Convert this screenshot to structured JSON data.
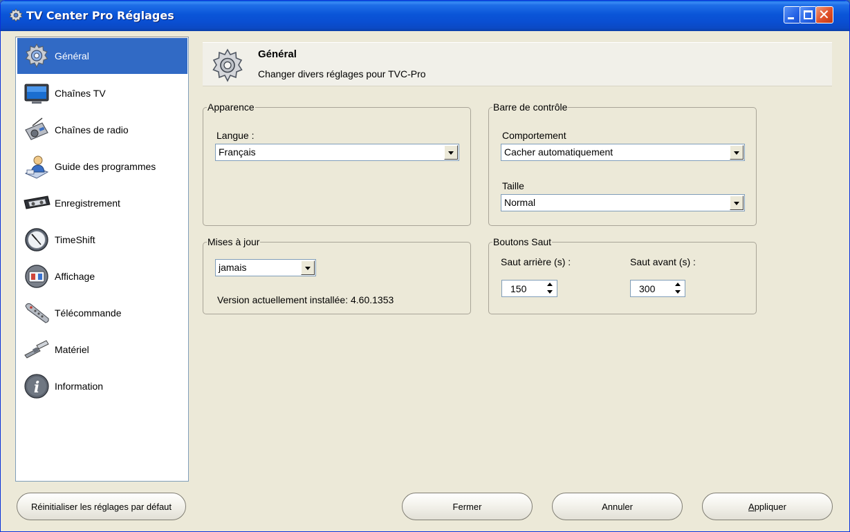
{
  "window": {
    "title": "TV Center Pro Réglages"
  },
  "sidebar": {
    "items": [
      {
        "label": "Général",
        "icon": "gear-icon",
        "active": true
      },
      {
        "label": "Chaînes TV",
        "icon": "tv-icon"
      },
      {
        "label": "Chaînes de radio",
        "icon": "radio-icon"
      },
      {
        "label": "Guide des programmes",
        "icon": "program-guide-icon"
      },
      {
        "label": "Enregistrement",
        "icon": "cassette-icon"
      },
      {
        "label": "TimeShift",
        "icon": "clock-icon"
      },
      {
        "label": "Affichage",
        "icon": "display-icon"
      },
      {
        "label": "Télécommande",
        "icon": "remote-control-icon"
      },
      {
        "label": "Matériel",
        "icon": "hardware-icon"
      },
      {
        "label": "Information",
        "icon": "info-icon"
      }
    ]
  },
  "header": {
    "title": "Général",
    "subtitle": "Changer divers réglages pour TVC-Pro"
  },
  "appearance": {
    "legend": "Apparence",
    "language_label": "Langue :",
    "language_value": "Français"
  },
  "control_bar": {
    "legend": "Barre de contrôle",
    "behavior_label": "Comportement",
    "behavior_value": "Cacher automatiquement",
    "size_label": "Taille",
    "size_value": "Normal"
  },
  "updates": {
    "legend": "Mises à jour",
    "frequency_value": "jamais",
    "version_text": "Version actuellement installée: 4.60.1353"
  },
  "jump_buttons": {
    "legend": "Boutons Saut",
    "back_label": "Saut arrière (s) :",
    "back_value": "150",
    "forward_label": "Saut avant (s) :",
    "forward_value": "300"
  },
  "footer": {
    "reset_label": "Réinitialiser les réglages par défaut",
    "close_label": "Fermer",
    "cancel_label": "Annuler",
    "apply_prefix": "A",
    "apply_rest": "ppliquer"
  },
  "colors": {
    "accent": "#316ac5",
    "titlebar": "#0a55d8",
    "face": "#ece9d8"
  }
}
